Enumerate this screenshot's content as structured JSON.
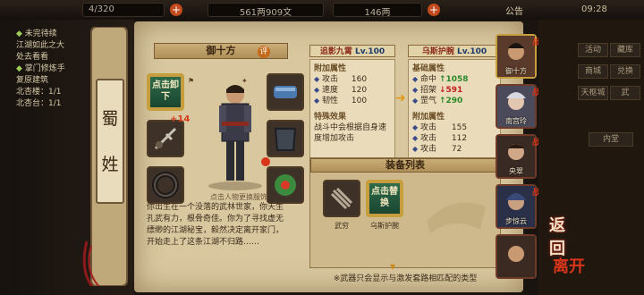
{
  "topbar": {
    "res1": "4/320",
    "res2": "561两909文",
    "res3": "146两",
    "notice": "公告",
    "clock": "09:28"
  },
  "quests": [
    {
      "mark": "◆",
      "label": "未完待续"
    },
    {
      "mark": "",
      "label": "江湖如此之大"
    },
    {
      "mark": "",
      "label": "处去看看"
    },
    {
      "mark": "◆",
      "label": "掌门修炼手"
    },
    {
      "mark": "",
      "label": "复原建筑"
    },
    {
      "mark": "",
      "label": "北杏楼：1/1"
    },
    {
      "mark": "",
      "label": "北杏台：1/1"
    }
  ],
  "faction": {
    "char1": "蜀",
    "char2": "姓"
  },
  "character": {
    "name": "御十方",
    "rank_badge": "评",
    "unequip": "点击卸下",
    "plus_level": "+14",
    "hint": "点击人物更换服饰",
    "bio": "你出生在一个没落的武林世家，你天生孔武有力，根骨奇佳。你为了寻找虚无缥缈的江湖秘宝，毅然决定离开家门，开始走上了这条江湖不归路……"
  },
  "weapon_current": {
    "title": "追影九霄",
    "level": "Lv.100",
    "attr_header": "附加属性",
    "stats": [
      {
        "name": "攻击",
        "value": "160"
      },
      {
        "name": "速度",
        "value": "120"
      },
      {
        "name": "韧性",
        "value": "100"
      }
    ],
    "special_header": "特殊效果",
    "special_text": "战斗中会根据自身速度增加攻击"
  },
  "weapon_compare": {
    "title": "乌斯护腕",
    "level": "Lv.100",
    "base_header": "基础属性",
    "base_stats": [
      {
        "name": "命中",
        "delta": "↑1058",
        "color": "#2a8a2a"
      },
      {
        "name": "招架",
        "delta": "↓591",
        "color": "#c02020"
      },
      {
        "name": "罡气",
        "delta": "↑290",
        "color": "#2a8a2a"
      }
    ],
    "attr_header": "附加属性",
    "attr_stats": [
      {
        "name": "攻击",
        "value": "155"
      },
      {
        "name": "攻击",
        "value": "112"
      },
      {
        "name": "攻击",
        "value": "72"
      }
    ]
  },
  "equip_list": {
    "title": "装备列表",
    "items": [
      {
        "label": "武穷"
      },
      {
        "label": "乌斯护腕"
      }
    ],
    "swap": "点击替换",
    "footnote": "※武器只会显示与激发套路相匹配的类型"
  },
  "roster": [
    {
      "name": "御十方",
      "war": "战"
    },
    {
      "name": "南宫玲",
      "war": "战"
    },
    {
      "name": "央翠",
      "war": "战"
    },
    {
      "name": "步惊云",
      "war": "战"
    },
    {
      "name": "",
      "war": ""
    }
  ],
  "rightmenu": {
    "btns": [
      "活动",
      "藏库",
      "商城",
      "兑换",
      "天枢城",
      "武"
    ],
    "inner": "内堂",
    "back1": "返",
    "back2": "回",
    "exit1": "离",
    "exit2": "开"
  },
  "colors": {
    "accent_red": "#c02020",
    "accent_green": "#2a8a2a",
    "paper": "#d8c79f"
  }
}
